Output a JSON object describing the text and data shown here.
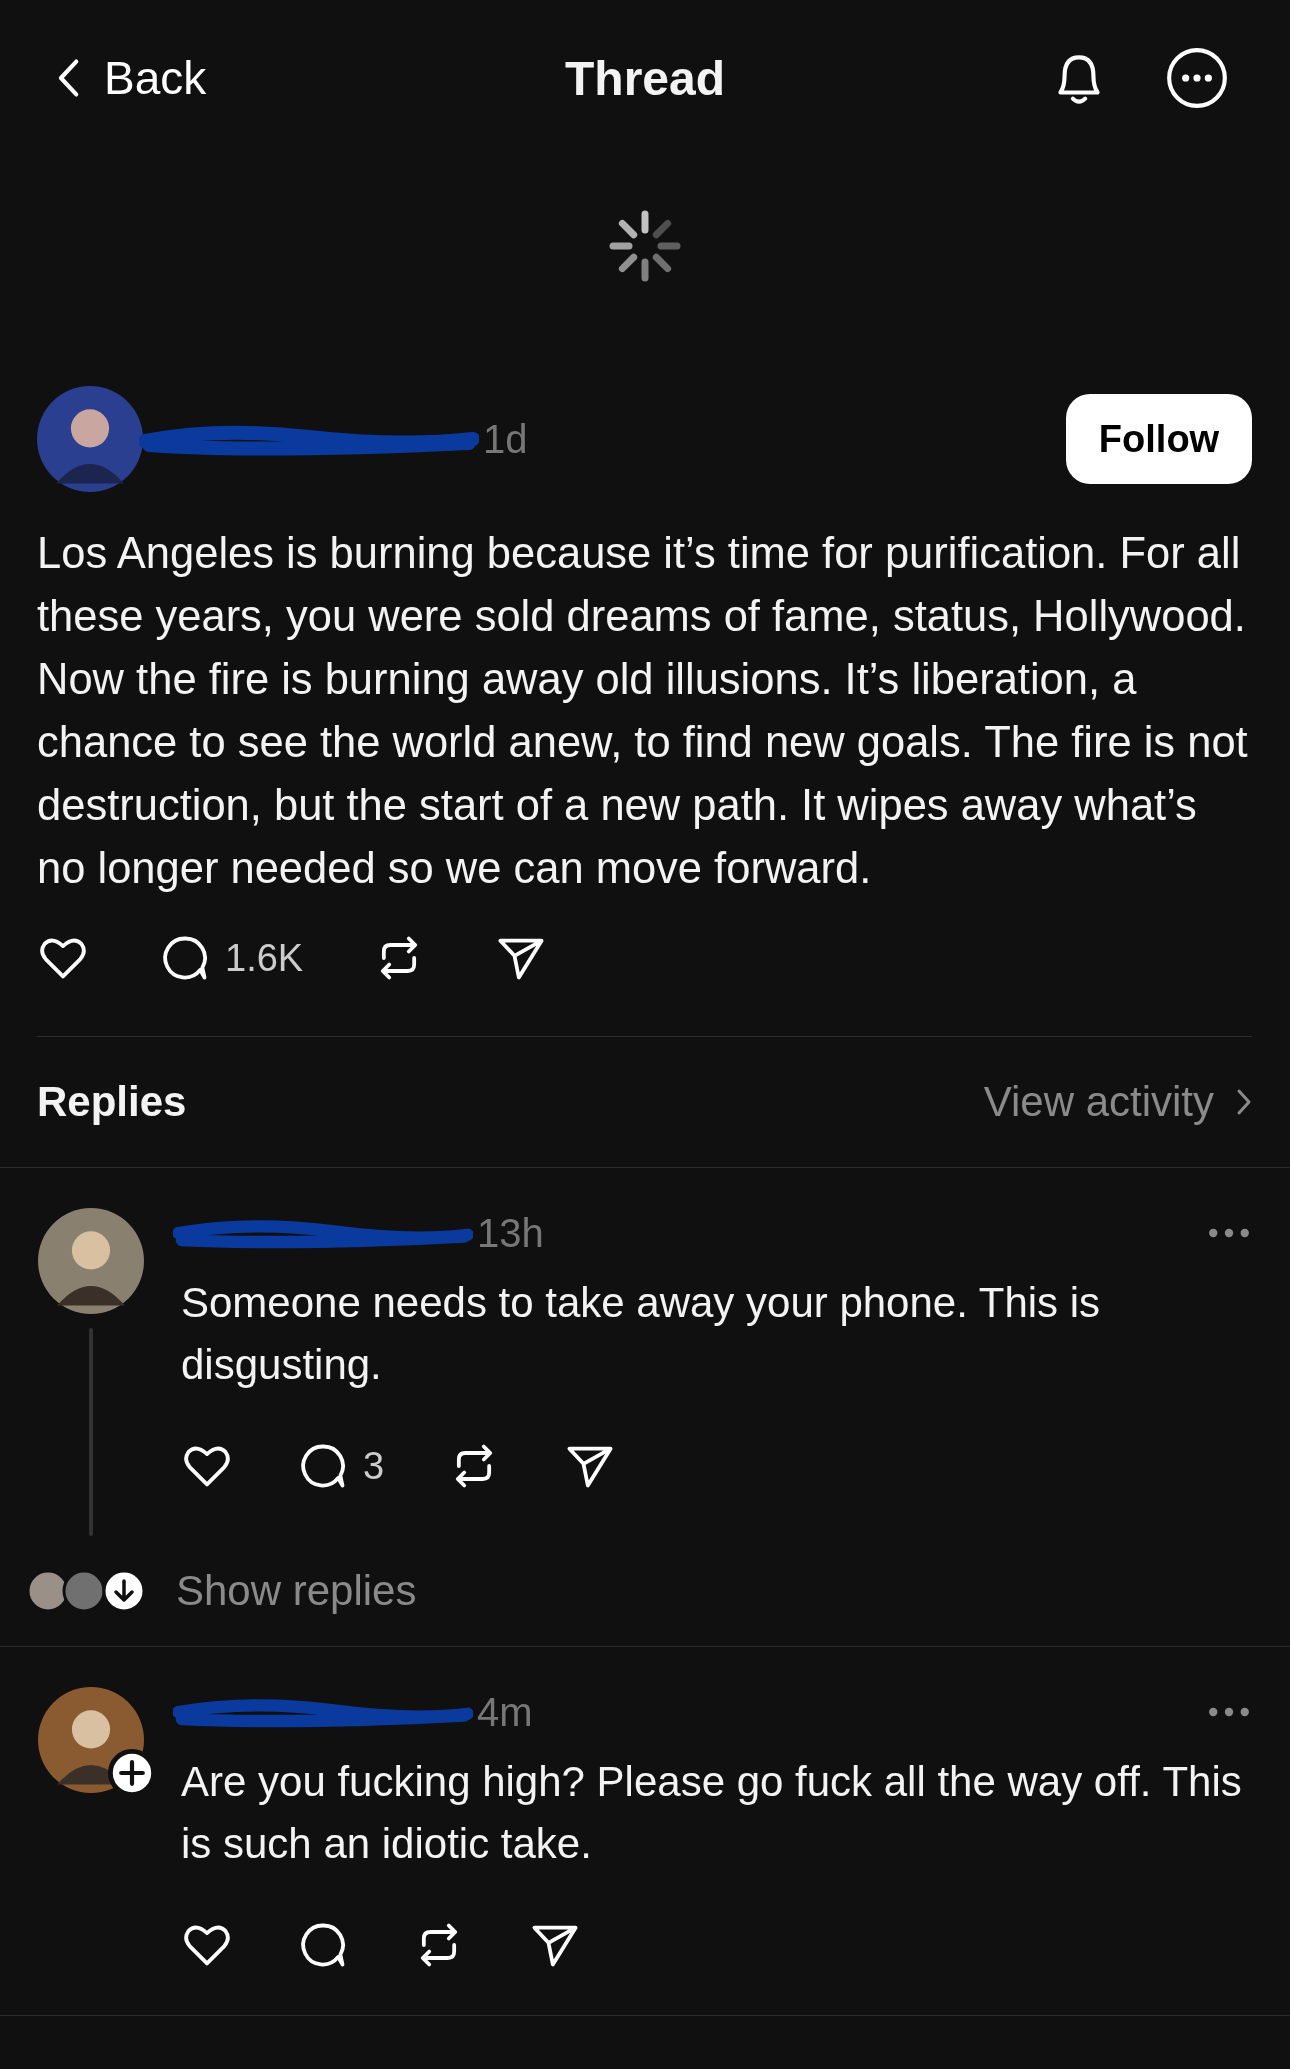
{
  "header": {
    "back": "Back",
    "title": "Thread"
  },
  "post": {
    "time": "1d",
    "follow": "Follow",
    "text": "Los Angeles is burning because it’s time for purification. For all these years, you were sold dreams of fame, status, Hollywood. Now the fire is burning away old illusions. It’s liberation, a chance to see the world anew, to find new goals. The fire is not destruction, but the start of a new path. It wipes away what’s no longer needed so we can move forward.",
    "reply_count": "1.6K"
  },
  "replies_header": {
    "title": "Replies",
    "link": "View activity"
  },
  "replies": [
    {
      "time": "13h",
      "text": "Someone needs to take away your phone. This is disgusting.",
      "reply_count": "3",
      "show_replies": "Show replies",
      "follow_badge": false
    },
    {
      "time": "4m",
      "text": "Are you fucking high? Please go fuck all the way off. This is such an idiotic take.",
      "follow_badge": true
    }
  ]
}
